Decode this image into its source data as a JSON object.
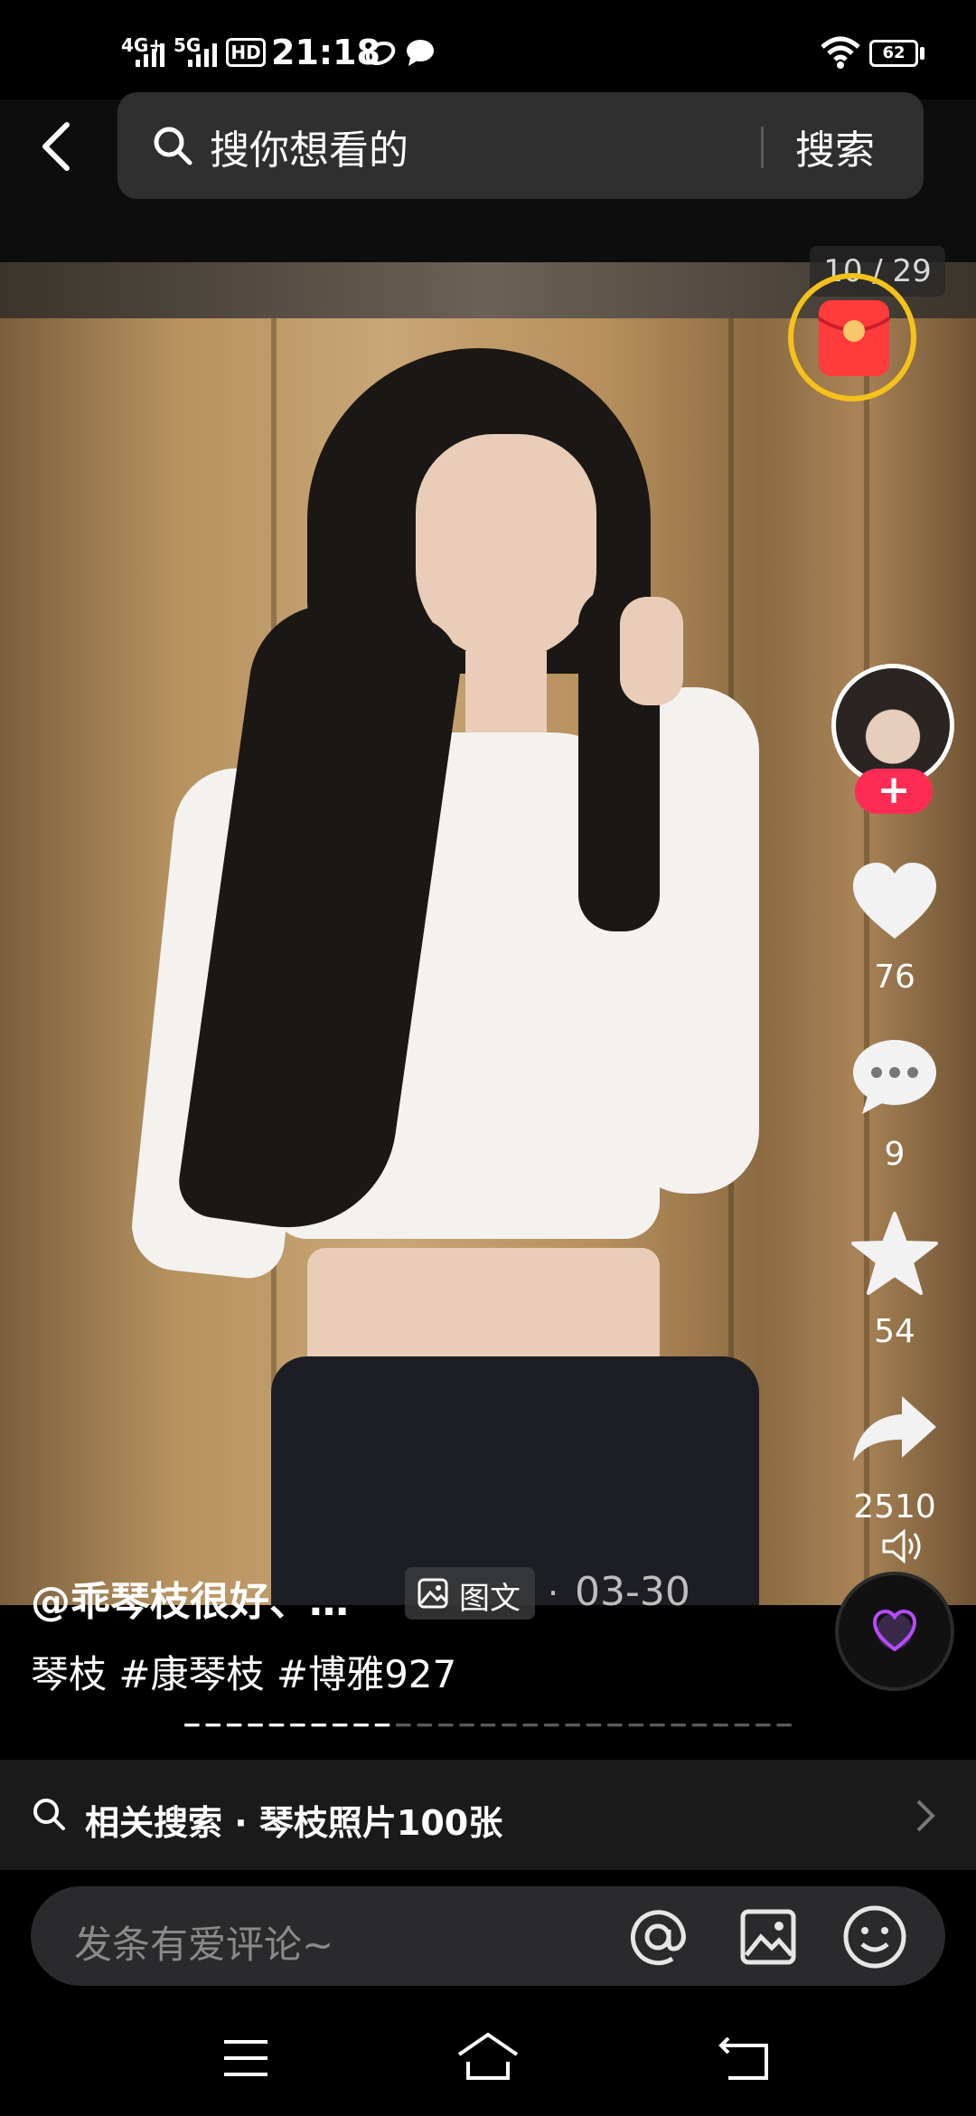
{
  "status_bar": {
    "time": "21:18",
    "network_1": "4G+",
    "network_2": "5G",
    "hd_label": "HD",
    "battery": "62"
  },
  "header": {
    "search_placeholder": "搜你想看的",
    "search_button": "搜索"
  },
  "image_counter": "10 / 29",
  "rail": {
    "likes": "76",
    "comments": "9",
    "favorites": "54",
    "shares": "2510"
  },
  "post": {
    "username": "@乖琴枝很好、…",
    "type_label": "图文",
    "separator": "·",
    "date": "03-30",
    "description": "琴枝 #康琴枝 #博雅927",
    "progress_current": 10,
    "progress_total": 29
  },
  "related_search": {
    "label": "相关搜索",
    "separator": "·",
    "query": "琴枝照片100张"
  },
  "comment": {
    "placeholder": "发条有爱评论~"
  },
  "colors": {
    "accent_pink": "#fe2c55",
    "red_packet": "#ff3b3b",
    "ring_yellow": "#f5c21b"
  }
}
